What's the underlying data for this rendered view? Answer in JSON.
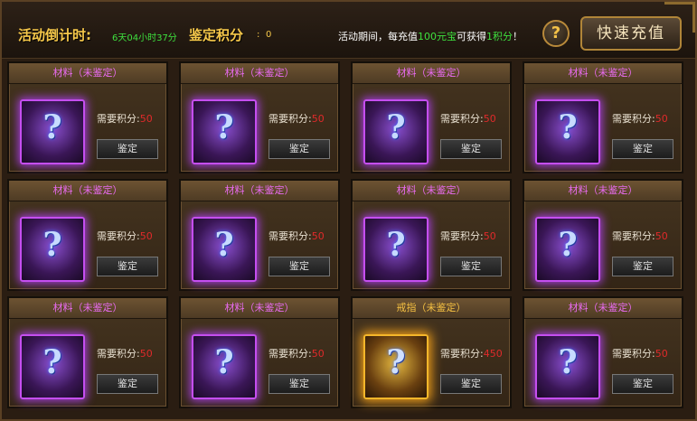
{
  "header": {
    "countdown_label": "活动倒计时",
    "countdown_value": "6天04小时37分",
    "points_label": "鉴定积分",
    "points_value": "0",
    "notice_prefix": "活动期间，每充值",
    "notice_amount": "100元宝",
    "notice_mid": "可获得",
    "notice_points": "1积分",
    "notice_suffix": "！",
    "help_icon": "?",
    "recharge_label": "快速充值"
  },
  "colors": {
    "gold": "#f6c84a",
    "green": "#3ee03e",
    "purple": "#e86bf0",
    "red": "#e02a2a"
  },
  "cards": [
    {
      "title": "材料（未鉴定）",
      "req_label": "需要积分",
      "colon": ":",
      "req_value": "50",
      "button": "鉴定",
      "icon": "question-mark-icon",
      "quality": "purple"
    },
    {
      "title": "材料（未鉴定）",
      "req_label": "需要积分",
      "colon": ":",
      "req_value": "50",
      "button": "鉴定",
      "icon": "question-mark-icon",
      "quality": "purple"
    },
    {
      "title": "材料（未鉴定）",
      "req_label": "需要积分",
      "colon": ":",
      "req_value": "50",
      "button": "鉴定",
      "icon": "question-mark-icon",
      "quality": "purple"
    },
    {
      "title": "材料（未鉴定）",
      "req_label": "需要积分",
      "colon": ":",
      "req_value": "50",
      "button": "鉴定",
      "icon": "question-mark-icon",
      "quality": "purple"
    },
    {
      "title": "材料（未鉴定）",
      "req_label": "需要积分",
      "colon": ":",
      "req_value": "50",
      "button": "鉴定",
      "icon": "question-mark-icon",
      "quality": "purple"
    },
    {
      "title": "材料（未鉴定）",
      "req_label": "需要积分",
      "colon": ":",
      "req_value": "50",
      "button": "鉴定",
      "icon": "question-mark-icon",
      "quality": "purple"
    },
    {
      "title": "材料（未鉴定）",
      "req_label": "需要积分",
      "colon": ":",
      "req_value": "50",
      "button": "鉴定",
      "icon": "question-mark-icon",
      "quality": "purple"
    },
    {
      "title": "材料（未鉴定）",
      "req_label": "需要积分",
      "colon": ":",
      "req_value": "50",
      "button": "鉴定",
      "icon": "question-mark-icon",
      "quality": "purple"
    },
    {
      "title": "材料（未鉴定）",
      "req_label": "需要积分",
      "colon": ":",
      "req_value": "50",
      "button": "鉴定",
      "icon": "question-mark-icon",
      "quality": "purple"
    },
    {
      "title": "材料（未鉴定）",
      "req_label": "需要积分",
      "colon": ":",
      "req_value": "50",
      "button": "鉴定",
      "icon": "question-mark-icon",
      "quality": "purple"
    },
    {
      "title": "戒指（未鉴定）",
      "req_label": "需要积分",
      "colon": ":",
      "req_value": "450",
      "button": "鉴定",
      "icon": "question-mark-icon",
      "quality": "gold"
    },
    {
      "title": "材料（未鉴定）",
      "req_label": "需要积分",
      "colon": ":",
      "req_value": "50",
      "button": "鉴定",
      "icon": "question-mark-icon",
      "quality": "purple"
    }
  ]
}
